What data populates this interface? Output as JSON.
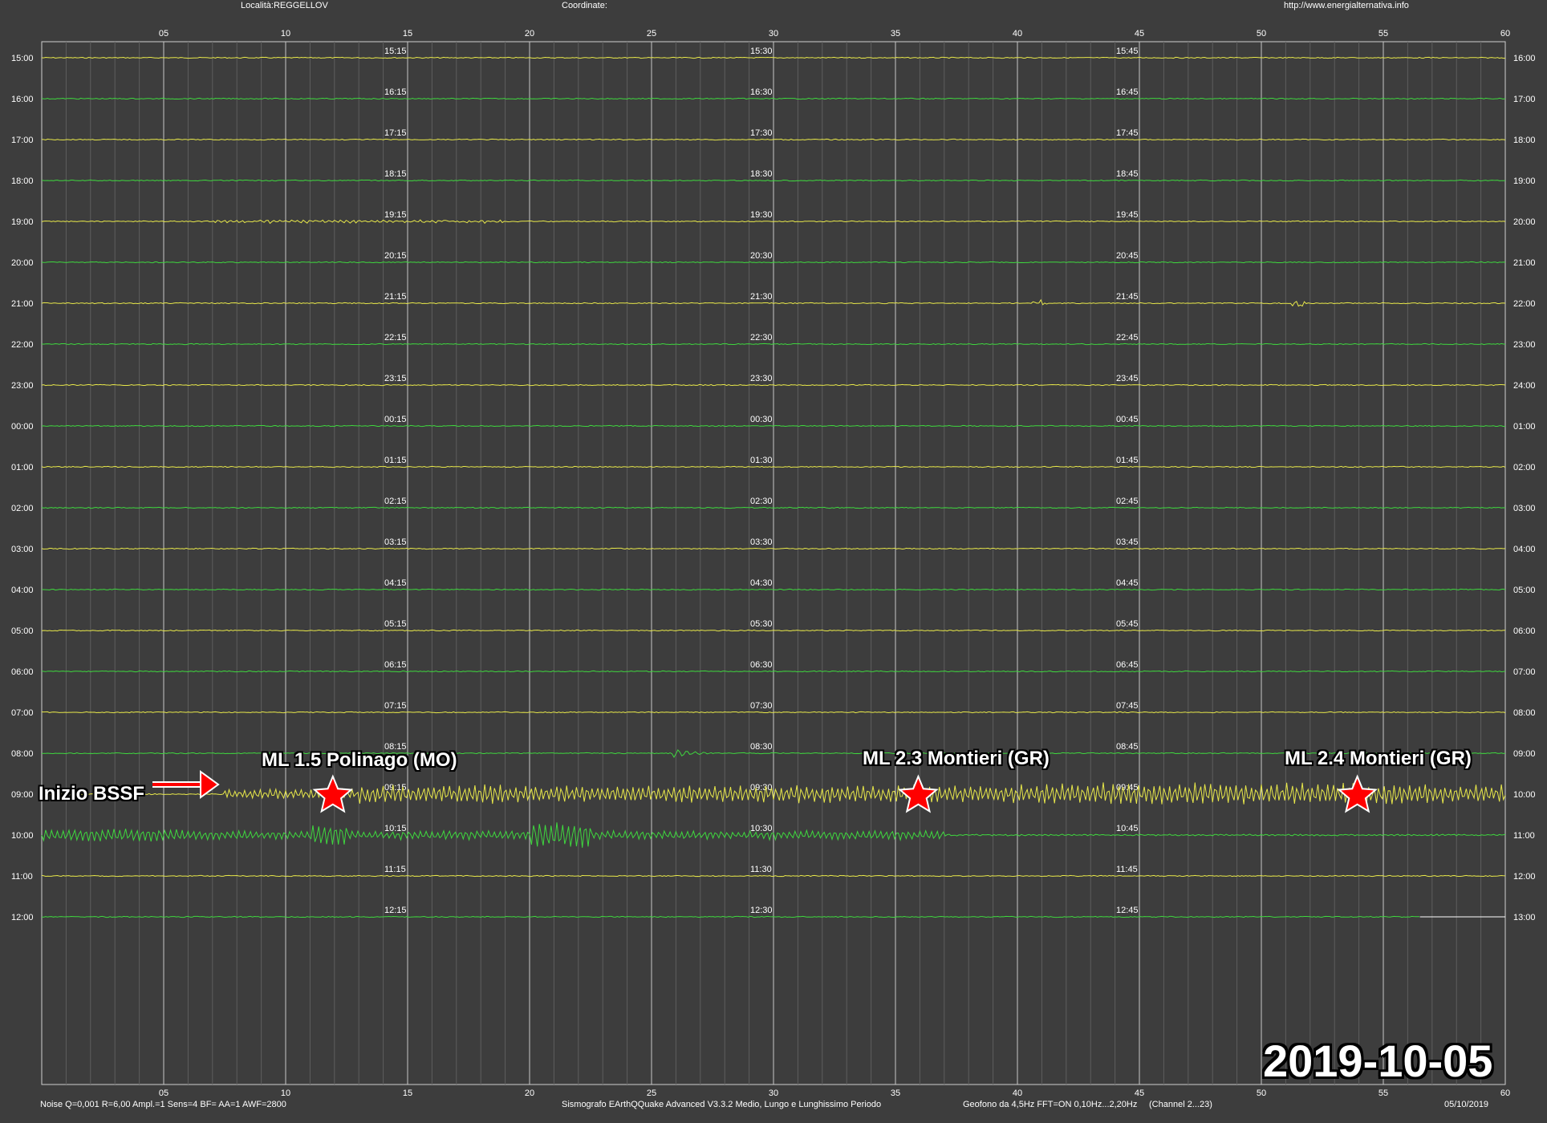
{
  "header": {
    "location": "Località:REGGELLOV",
    "coordinates": "Coordinate:",
    "url": "http://www.energialternativa.info"
  },
  "footer": {
    "settings": "Noise Q=0,001 R=6,00 Ampl.=1 Sens=4 BF= AA=1 AWF=2800",
    "software": "Sismografo  EArthQQuake Advanced V3.3.2  Medio, Lungo e Lunghissimo Periodo",
    "sensor": "Geofono da 4,5Hz FFT=ON 0,10Hz...2,20Hz",
    "channel": "(Channel 2...23)",
    "date": "05/10/2019"
  },
  "date_stamp": "2019-10-05",
  "annotations": {
    "start": "Inizio BSSF",
    "event1": "ML 1.5 Polinago (MO)",
    "event2": "ML 2.3 Montieri (GR)",
    "event3": "ML 2.4 Montieri (GR)"
  },
  "colors": {
    "background": "#3d3d3d",
    "grid": "#b4b4b4",
    "trace_yellow": "#e8e84a",
    "trace_green": "#3ed83e",
    "annotation_red": "#ff0000"
  },
  "chart_data": {
    "type": "line",
    "x_ticks": [
      "05",
      "10",
      "15",
      "20",
      "25",
      "30",
      "35",
      "40",
      "45",
      "50",
      "55",
      "60"
    ],
    "xlim": [
      0,
      60
    ],
    "left_labels": [
      "15:00",
      "16:00",
      "17:00",
      "18:00",
      "19:00",
      "20:00",
      "21:00",
      "22:00",
      "23:00",
      "00:00",
      "01:00",
      "02:00",
      "03:00",
      "04:00",
      "05:00",
      "06:00",
      "07:00",
      "08:00",
      "09:00",
      "10:00",
      "11:00",
      "12:00"
    ],
    "right_labels": [
      "16:00",
      "17:00",
      "18:00",
      "19:00",
      "20:00",
      "21:00",
      "22:00",
      "23:00",
      "24:00",
      "01:00",
      "02:00",
      "03:00",
      "04:00",
      "05:00",
      "06:00",
      "07:00",
      "08:00",
      "09:00",
      "10:00",
      "11:00",
      "12:00",
      "13:00"
    ],
    "col15_labels": [
      "15:15",
      "16:15",
      "17:15",
      "18:15",
      "19:15",
      "20:15",
      "21:15",
      "22:15",
      "23:15",
      "00:15",
      "01:15",
      "02:15",
      "03:15",
      "04:15",
      "05:15",
      "06:15",
      "07:15",
      "08:15",
      "09:15",
      "10:15",
      "11:15",
      "12:15"
    ],
    "col30_labels": [
      "15:30",
      "16:30",
      "17:30",
      "18:30",
      "19:30",
      "20:30",
      "21:30",
      "22:30",
      "23:30",
      "00:30",
      "01:30",
      "02:30",
      "03:30",
      "04:30",
      "05:30",
      "06:30",
      "07:30",
      "08:30",
      "09:30",
      "10:30",
      "11:30",
      "12:30"
    ],
    "col45_labels": [
      "15:45",
      "16:45",
      "17:45",
      "18:45",
      "19:45",
      "20:45",
      "21:45",
      "22:45",
      "23:45",
      "00:45",
      "01:45",
      "02:45",
      "03:45",
      "04:45",
      "05:45",
      "06:45",
      "07:45",
      "08:45",
      "09:45",
      "10:45",
      "11:45",
      "12:45"
    ],
    "events": [
      {
        "label": "ML 1.5 Polinago (MO)",
        "trace": "09:00",
        "minute": 12
      },
      {
        "label": "ML 2.3 Montieri (GR)",
        "trace": "09:00",
        "minute": 36
      },
      {
        "label": "ML 2.4 Montieri (GR)",
        "trace": "09:00",
        "minute": 54
      }
    ],
    "bssf_start": {
      "label": "Inizio BSSF",
      "trace": "09:00",
      "minute": 7.5
    }
  }
}
